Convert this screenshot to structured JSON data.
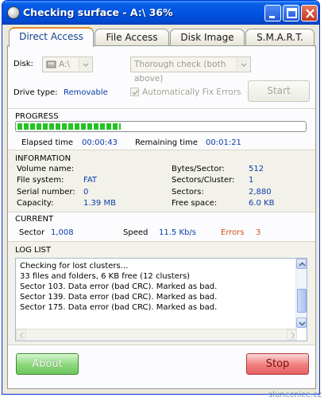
{
  "window": {
    "title": "Checking surface - A:\\ 36%",
    "icon": "app-disc-icon",
    "controls": [
      "minimize-icon",
      "maximize-icon",
      "close-icon"
    ]
  },
  "tabs": [
    {
      "label": "Direct Access",
      "active": true
    },
    {
      "label": "File Access",
      "active": false
    },
    {
      "label": "Disk Image",
      "active": false
    },
    {
      "label": "S.M.A.R.T.",
      "active": false
    }
  ],
  "disk": {
    "label": "Disk:",
    "selected": "A:\\",
    "check_mode": "Thorough check (both above)"
  },
  "drive": {
    "type_label": "Drive type:",
    "type_value": "Removable",
    "auto_fix_label": "Automatically Fix Errors",
    "start_label": "Start"
  },
  "progress": {
    "title": "PROGRESS",
    "percent": 36,
    "elapsed_label": "Elapsed time",
    "elapsed_value": "00:00:43",
    "remaining_label": "Remaining time",
    "remaining_value": "00:01:21"
  },
  "information": {
    "title": "INFORMATION",
    "volume_label": "Volume name:",
    "volume_value": "",
    "fs_label": "File system:",
    "fs_value": "FAT",
    "serial_label": "Serial number:",
    "serial_value": "0",
    "capacity_label": "Capacity:",
    "capacity_value": "1.39 MB",
    "bps_label": "Bytes/Sector:",
    "bps_value": "512",
    "spc_label": "Sectors/Cluster:",
    "spc_value": "1",
    "sectors_label": "Sectors:",
    "sectors_value": "2,880",
    "free_label": "Free space:",
    "free_value": "6.0 KB"
  },
  "current": {
    "title": "CURRENT",
    "sector_label": "Sector",
    "sector_value": "1,008",
    "speed_label": "Speed",
    "speed_value": "11.5 Kb/s",
    "errors_label": "Errors",
    "errors_value": "3"
  },
  "log": {
    "title": "LOG LIST",
    "lines": [
      "Checking for lost clusters...",
      "33 files and folders, 6 KB free (12 clusters)",
      "Sector 103. Data error (bad CRC). Marked as bad.",
      "Sector 139. Data error (bad CRC). Marked as bad.",
      "Sector 175. Data error (bad CRC). Marked as bad."
    ]
  },
  "buttons": {
    "about": "About",
    "stop": "Stop"
  },
  "watermark": "slunecnice.cz",
  "colors": {
    "accent_blue": "#0a3da8",
    "error_orange": "#d2501a",
    "progress_green": "#22c322",
    "titlebar": "#0054e3"
  }
}
